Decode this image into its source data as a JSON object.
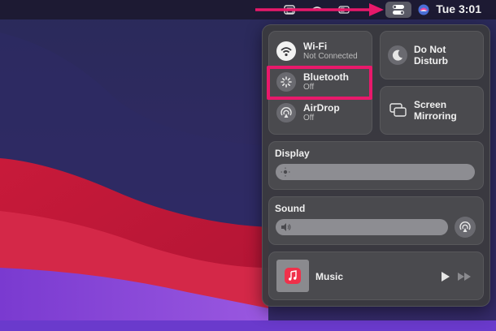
{
  "menubar": {
    "clock": "Tue 3:01",
    "icons": [
      "window-icon",
      "wifi-icon",
      "battery-icon",
      "control-center-icon",
      "siri-icon"
    ]
  },
  "control_center": {
    "connectivity": [
      {
        "title": "Wi-Fi",
        "status": "Not Connected",
        "icon": "wifi-icon"
      },
      {
        "title": "Bluetooth",
        "status": "Off",
        "icon": "bluetooth-icon"
      },
      {
        "title": "AirDrop",
        "status": "Off",
        "icon": "airdrop-icon"
      }
    ],
    "do_not_disturb": {
      "line1": "Do Not",
      "line2": "Disturb"
    },
    "screen_mirroring": {
      "line1": "Screen",
      "line2": "Mirroring"
    },
    "display": {
      "title": "Display",
      "level": 1.0
    },
    "sound": {
      "title": "Sound",
      "level": 1.0
    },
    "music": {
      "title": "Music"
    }
  },
  "colors": {
    "highlight": "#e8196b",
    "arrow": "#e8196b",
    "panel": "#3a3a3e",
    "tile": "#4a4a4e"
  }
}
